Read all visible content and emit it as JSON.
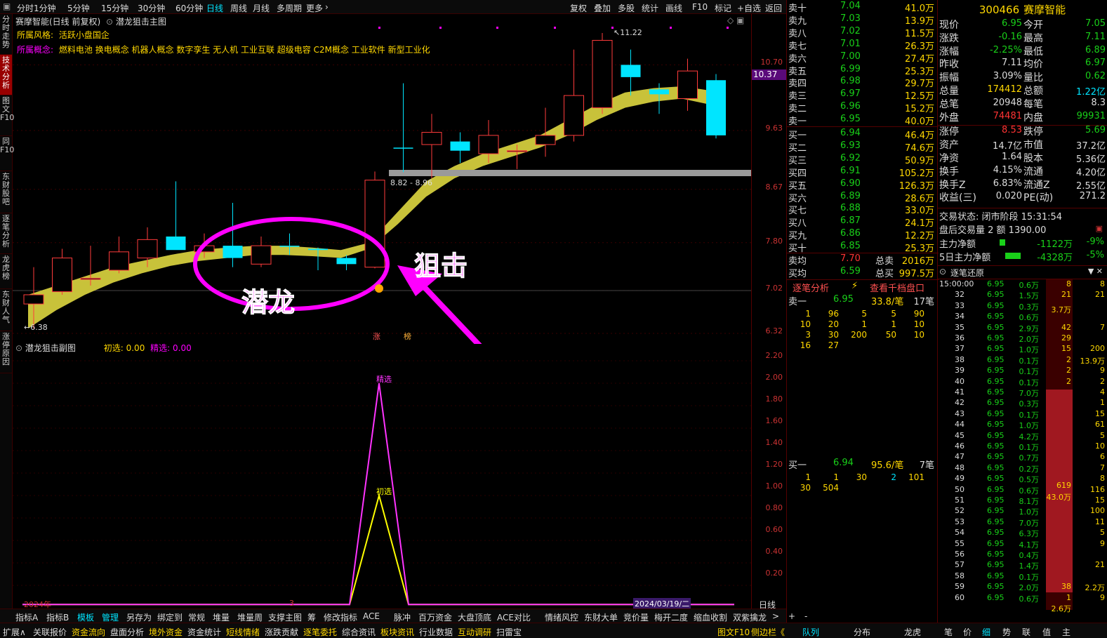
{
  "toolbar": {
    "periods": [
      "分时",
      "1分钟",
      "5分钟",
      "15分钟",
      "30分钟",
      "60分钟",
      "日线",
      "周线",
      "月线",
      "多周期",
      "更多"
    ],
    "active_period": "日线",
    "right_buttons": [
      "复权",
      "叠加",
      "多股",
      "统计",
      "画线",
      "F10",
      "标记",
      "+自选",
      "返回"
    ]
  },
  "sidebar": {
    "tabs": [
      "分时走势",
      "技术分析",
      "图文F10",
      "同F10",
      "东财股吧",
      "逐笔分析",
      "龙虎榜",
      "东财人气",
      "涨停原因"
    ],
    "active": "技术分析"
  },
  "chart_header": {
    "stock": "赛摩智能(日线 前复权)",
    "indicator": "潜龙狙击主图",
    "style_label": "所属风格:",
    "style_value": "活跃小盘国企",
    "concept_label": "所属概念:",
    "concept_value": "燃料电池 换电概念 机器人概念 数字孪生 无人机 工业互联 超级电容 C2M概念 工业软件 新型工业化"
  },
  "chart_data": [
    {
      "type": "candlestick",
      "title": "潜龙狙击主图",
      "y_ticks": [
        "10.70",
        "9.63",
        "8.67",
        "7.80",
        "7.02",
        "6.32"
      ],
      "current_price_tag": "10.37",
      "ylim": [
        6.32,
        11.3
      ],
      "candles": [
        {
          "o": 6.8,
          "h": 7.4,
          "l": 6.4,
          "c": 6.95,
          "color": "red"
        },
        {
          "o": 7.0,
          "h": 7.7,
          "l": 6.95,
          "c": 7.55,
          "color": "red"
        },
        {
          "o": 7.2,
          "h": 7.75,
          "l": 7.1,
          "c": 7.22,
          "color": "red"
        },
        {
          "o": 7.35,
          "h": 7.9,
          "l": 7.3,
          "c": 7.65,
          "color": "red"
        },
        {
          "o": 7.55,
          "h": 8.05,
          "l": 7.4,
          "c": 7.85,
          "color": "red"
        },
        {
          "o": 7.9,
          "h": 8.8,
          "l": 7.75,
          "c": 7.68,
          "color": "cyan"
        },
        {
          "o": 7.65,
          "h": 7.95,
          "l": 7.55,
          "c": 7.75,
          "color": "red"
        },
        {
          "o": 7.75,
          "h": 8.45,
          "l": 7.4,
          "c": 7.55,
          "color": "cyan"
        },
        {
          "o": 7.45,
          "h": 7.9,
          "l": 7.4,
          "c": 7.75,
          "color": "red"
        },
        {
          "o": 7.75,
          "h": 7.95,
          "l": 7.6,
          "c": 7.75,
          "color": "cyan"
        },
        {
          "o": 7.7,
          "h": 7.72,
          "l": 7.35,
          "c": 7.68,
          "color": "cyan"
        },
        {
          "o": 7.55,
          "h": 7.6,
          "l": 7.35,
          "c": 7.45,
          "color": "cyan"
        },
        {
          "o": 7.4,
          "h": 8.96,
          "l": 7.38,
          "c": 8.82,
          "color": "red"
        },
        {
          "o": 9.35,
          "h": 10.4,
          "l": 8.95,
          "c": 9.35,
          "color": "cyan"
        },
        {
          "o": 9.4,
          "h": 9.9,
          "l": 8.85,
          "c": 9.6,
          "color": "red"
        },
        {
          "o": 9.45,
          "h": 9.6,
          "l": 9.1,
          "c": 9.3,
          "color": "cyan"
        },
        {
          "o": 9.25,
          "h": 9.8,
          "l": 9.1,
          "c": 9.55,
          "color": "red"
        },
        {
          "o": 9.3,
          "h": 9.4,
          "l": 9.0,
          "c": 9.3,
          "color": "red"
        },
        {
          "o": 9.4,
          "h": 10.0,
          "l": 9.2,
          "c": 9.55,
          "color": "red"
        },
        {
          "o": 9.55,
          "h": 10.95,
          "l": 9.45,
          "c": 10.2,
          "color": "red"
        },
        {
          "o": 10.0,
          "h": 11.22,
          "l": 9.9,
          "c": 11.1,
          "color": "red"
        },
        {
          "o": 10.7,
          "h": 10.95,
          "l": 10.2,
          "c": 10.5,
          "color": "cyan"
        },
        {
          "o": 10.3,
          "h": 10.4,
          "l": 9.9,
          "c": 10.22,
          "color": "cyan"
        },
        {
          "o": 10.15,
          "h": 10.8,
          "l": 9.95,
          "c": 10.6,
          "color": "red"
        },
        {
          "o": 10.45,
          "h": 10.55,
          "l": 9.5,
          "c": 9.55,
          "color": "cyan"
        }
      ],
      "band_upper": [
        6.95,
        7.1,
        7.25,
        7.4,
        7.5,
        7.6,
        7.68,
        7.72,
        7.75,
        7.75,
        7.72,
        7.68,
        7.8,
        8.3,
        8.8,
        9.05,
        9.25,
        9.4,
        9.55,
        9.8,
        10.05,
        10.25,
        10.32,
        10.35,
        10.28
      ],
      "band_lower": [
        6.4,
        6.7,
        6.95,
        7.15,
        7.3,
        7.42,
        7.5,
        7.55,
        7.6,
        7.6,
        7.58,
        7.55,
        7.7,
        8.1,
        8.55,
        8.85,
        9.05,
        9.2,
        9.35,
        9.55,
        9.8,
        10.0,
        10.1,
        10.15,
        10.05
      ],
      "annotations": {
        "low_label": "6.38",
        "high_label": "11.22",
        "range_label": "8.82 - 8.96",
        "circle_text": "潜龙",
        "arrow_text": "狙击",
        "markers": [
          "涨",
          "榜"
        ]
      }
    },
    {
      "type": "line",
      "title": "潜龙狙击副图",
      "legend": [
        {
          "name": "初选",
          "value": "0.00"
        },
        {
          "name": "精选",
          "value": "0.00"
        }
      ],
      "y_ticks": [
        "2.20",
        "2.00",
        "1.80",
        "1.60",
        "1.40",
        "1.20",
        "1.00",
        "0.80",
        "0.60",
        "0.40",
        "0.20"
      ],
      "ylim": [
        0,
        2.25
      ],
      "series": [
        {
          "name": "初选",
          "peak_index": 12,
          "peak_value": 1.0,
          "color": "#ffff00"
        },
        {
          "name": "精选",
          "peak_index": 12,
          "peak_value": 2.0,
          "color": "#ff33ff"
        }
      ],
      "x_labels": [
        "2024年",
        "3"
      ],
      "date_label": "2024/03/19/二",
      "period_label": "日线"
    }
  ],
  "bottom_tabs": [
    "指标A",
    "指标B",
    "模板",
    "管理",
    "另存为",
    "绑定到",
    "常规",
    "堆量",
    "堆量周",
    "支撑主图",
    "筹",
    "修改指标",
    "ACE",
    "脉冲",
    "百万资金",
    "大盘顶底",
    "ACE对比",
    "情绪风控",
    "东财大单",
    "竞价量",
    "梅开二度",
    "缩血收割",
    "双紫擒龙",
    ">",
    "+",
    "-"
  ],
  "status_tabs": [
    "扩展∧",
    "关联报价",
    "资金流向",
    "盘面分析",
    "境外资金",
    "资金统计",
    "短线情绪",
    "涨跌贡献",
    "逐笔委托",
    "综合资讯",
    "板块资讯",
    "行业数据",
    "互动调研",
    "扫雷宝"
  ],
  "status_right": [
    "图文F10",
    "侧边栏《"
  ],
  "right_bottom_tabs": [
    "队列",
    "分布",
    "龙虎",
    "笔",
    "价",
    "细",
    "势",
    "联",
    "值",
    "主"
  ],
  "orderbook": {
    "sells": [
      {
        "label": "卖十",
        "price": "7.04",
        "vol": "41.0万"
      },
      {
        "label": "卖九",
        "price": "7.03",
        "vol": "13.9万"
      },
      {
        "label": "卖八",
        "price": "7.02",
        "vol": "11.5万"
      },
      {
        "label": "卖七",
        "price": "7.01",
        "vol": "26.3万"
      },
      {
        "label": "卖六",
        "price": "7.00",
        "vol": "27.4万"
      },
      {
        "label": "卖五",
        "price": "6.99",
        "vol": "25.3万"
      },
      {
        "label": "卖四",
        "price": "6.98",
        "vol": "29.7万"
      },
      {
        "label": "卖三",
        "price": "6.97",
        "vol": "12.5万"
      },
      {
        "label": "卖二",
        "price": "6.96",
        "vol": "15.2万"
      },
      {
        "label": "卖一",
        "price": "6.95",
        "vol": "40.0万"
      }
    ],
    "buys": [
      {
        "label": "买一",
        "price": "6.94",
        "vol": "46.4万"
      },
      {
        "label": "买二",
        "price": "6.93",
        "vol": "74.6万"
      },
      {
        "label": "买三",
        "price": "6.92",
        "vol": "50.9万"
      },
      {
        "label": "买四",
        "price": "6.91",
        "vol": "105.2万"
      },
      {
        "label": "买五",
        "price": "6.90",
        "vol": "126.3万"
      },
      {
        "label": "买六",
        "price": "6.89",
        "vol": "28.6万"
      },
      {
        "label": "买七",
        "price": "6.88",
        "vol": "33.0万"
      },
      {
        "label": "买八",
        "price": "6.87",
        "vol": "24.1万"
      },
      {
        "label": "买九",
        "price": "6.86",
        "vol": "12.2万"
      },
      {
        "label": "买十",
        "price": "6.85",
        "vol": "25.3万"
      }
    ],
    "avg_sell": {
      "label": "卖均",
      "price": "7.70",
      "tlabel": "总卖",
      "vol": "2016万"
    },
    "avg_buy": {
      "label": "买均",
      "price": "6.59",
      "tlabel": "总买",
      "vol": "997.5万"
    },
    "tabs": [
      "逐笔分析",
      "查看千档盘口"
    ],
    "sell1_summary": {
      "label": "卖一",
      "price": "6.95",
      "avg": "33.8/笔",
      "count": "17笔"
    },
    "sell1_queue": [
      [
        "1",
        "96",
        "5",
        "5",
        "90"
      ],
      [
        "10",
        "20",
        "1",
        "1",
        "10"
      ],
      [
        "3",
        "30",
        "200",
        "50",
        "10"
      ],
      [
        "16",
        "27",
        "",
        "",
        ""
      ]
    ],
    "buy1_summary": {
      "label": "买一",
      "price": "6.94",
      "avg": "95.6/笔",
      "count": "7笔"
    },
    "buy1_queue": [
      [
        "1",
        "1",
        "30",
        "2",
        "101"
      ],
      [
        "30",
        "504",
        "",
        "",
        ""
      ]
    ]
  },
  "quote": {
    "code": "300466",
    "name": "赛摩智能",
    "rows": [
      [
        [
          "现价",
          "6.95",
          "g"
        ],
        [
          "今开",
          "7.05",
          "g"
        ]
      ],
      [
        [
          "涨跌",
          "-0.16",
          "g"
        ],
        [
          "最高",
          "7.11",
          "g"
        ]
      ],
      [
        [
          "涨幅",
          "-2.25%",
          "g"
        ],
        [
          "最低",
          "6.89",
          "g"
        ]
      ],
      [
        [
          "昨收",
          "7.11",
          "w"
        ],
        [
          "均价",
          "6.97",
          "g"
        ]
      ],
      [
        [
          "振幅",
          "3.09%",
          "w"
        ],
        [
          "量比",
          "0.62",
          "g"
        ]
      ],
      [
        [
          "总量",
          "174412",
          "y"
        ],
        [
          "总额",
          "1.22亿",
          "c"
        ]
      ],
      [
        [
          "总笔",
          "20948",
          "w"
        ],
        [
          "每笔",
          "8.3",
          "w"
        ]
      ],
      [
        [
          "外盘",
          "74481",
          "r"
        ],
        [
          "内盘",
          "99931",
          "g"
        ]
      ],
      [
        [
          "涨停",
          "8.53",
          "r"
        ],
        [
          "跌停",
          "5.69",
          "g"
        ]
      ],
      [
        [
          "资产",
          "14.7亿",
          "w"
        ],
        [
          "市值",
          "37.2亿",
          "w"
        ]
      ],
      [
        [
          "净资",
          "1.64",
          "w"
        ],
        [
          "股本",
          "5.36亿",
          "w"
        ]
      ],
      [
        [
          "换手",
          "4.15%",
          "w"
        ],
        [
          "流通",
          "4.20亿",
          "w"
        ]
      ],
      [
        [
          "换手Z",
          "6.83%",
          "w"
        ],
        [
          "流通Z",
          "2.55亿",
          "w"
        ]
      ],
      [
        [
          "收益(三)",
          "0.020",
          "w"
        ],
        [
          "PE(动)",
          "271.2",
          "w"
        ]
      ]
    ],
    "trade_status": "交易状态: 闭市阶段 15:31:54",
    "after_hours": "盘后交易量 2 额 1390.00",
    "main_net": {
      "label": "主力净额",
      "value": "-1122万",
      "pct": "-9%"
    },
    "main_net5": {
      "label": "5日主力净额",
      "value": "-4328万",
      "pct": "-5%"
    }
  },
  "tick_panel": {
    "title": "逐笔还原",
    "header_time": "15:00:00",
    "rows": [
      [
        "",
        "6.95",
        "0.6万"
      ],
      [
        "32",
        "6.95",
        "1.5万"
      ],
      [
        "33",
        "6.95",
        "0.3万"
      ],
      [
        "34",
        "6.95",
        "0.6万"
      ],
      [
        "35",
        "6.95",
        "2.9万"
      ],
      [
        "36",
        "6.95",
        "2.0万"
      ],
      [
        "37",
        "6.95",
        "1.0万"
      ],
      [
        "38",
        "6.95",
        "0.1万"
      ],
      [
        "39",
        "6.95",
        "0.1万"
      ],
      [
        "40",
        "6.95",
        "0.1万"
      ],
      [
        "41",
        "6.95",
        "7.0万"
      ],
      [
        "42",
        "6.95",
        "0.3万"
      ],
      [
        "43",
        "6.95",
        "0.1万"
      ],
      [
        "44",
        "6.95",
        "1.0万"
      ],
      [
        "45",
        "6.95",
        "4.2万"
      ],
      [
        "46",
        "6.95",
        "0.1万"
      ],
      [
        "47",
        "6.95",
        "0.7万"
      ],
      [
        "48",
        "6.95",
        "0.2万"
      ],
      [
        "49",
        "6.95",
        "0.5万"
      ],
      [
        "50",
        "6.95",
        "0.6万"
      ],
      [
        "51",
        "6.95",
        "8.1万"
      ],
      [
        "52",
        "6.95",
        "1.0万"
      ],
      [
        "53",
        "6.95",
        "7.0万"
      ],
      [
        "54",
        "6.95",
        "6.3万"
      ],
      [
        "55",
        "6.95",
        "4.1万"
      ],
      [
        "56",
        "6.95",
        "0.4万"
      ],
      [
        "57",
        "6.95",
        "1.4万"
      ],
      [
        "58",
        "6.95",
        "0.1万"
      ],
      [
        "59",
        "6.95",
        "2.0万"
      ],
      [
        "60",
        "6.95",
        "0.6万"
      ]
    ],
    "col3": [
      "8",
      "21",
      "",
      "",
      "42",
      "29",
      "15",
      "2",
      "2",
      "2",
      "",
      "",
      "",
      "",
      "",
      "",
      "",
      "",
      "",
      "",
      "",
      "",
      "",
      "",
      "",
      "",
      "",
      "",
      "38",
      "1"
    ],
    "col4": [
      "8",
      "21",
      "",
      "",
      "7",
      "",
      "200",
      "13.9万",
      "9",
      "2",
      "4",
      "1",
      "15",
      "61",
      "5",
      "10",
      "6",
      "7",
      "8",
      "116",
      "15",
      "100",
      "11",
      "5",
      "9",
      "",
      "21",
      "",
      "2.2万",
      "9"
    ],
    "mid_labels": {
      "a": "53",
      "b": "3.7万",
      "c": "619",
      "d": "43.0万",
      "e": "2.6万"
    }
  }
}
